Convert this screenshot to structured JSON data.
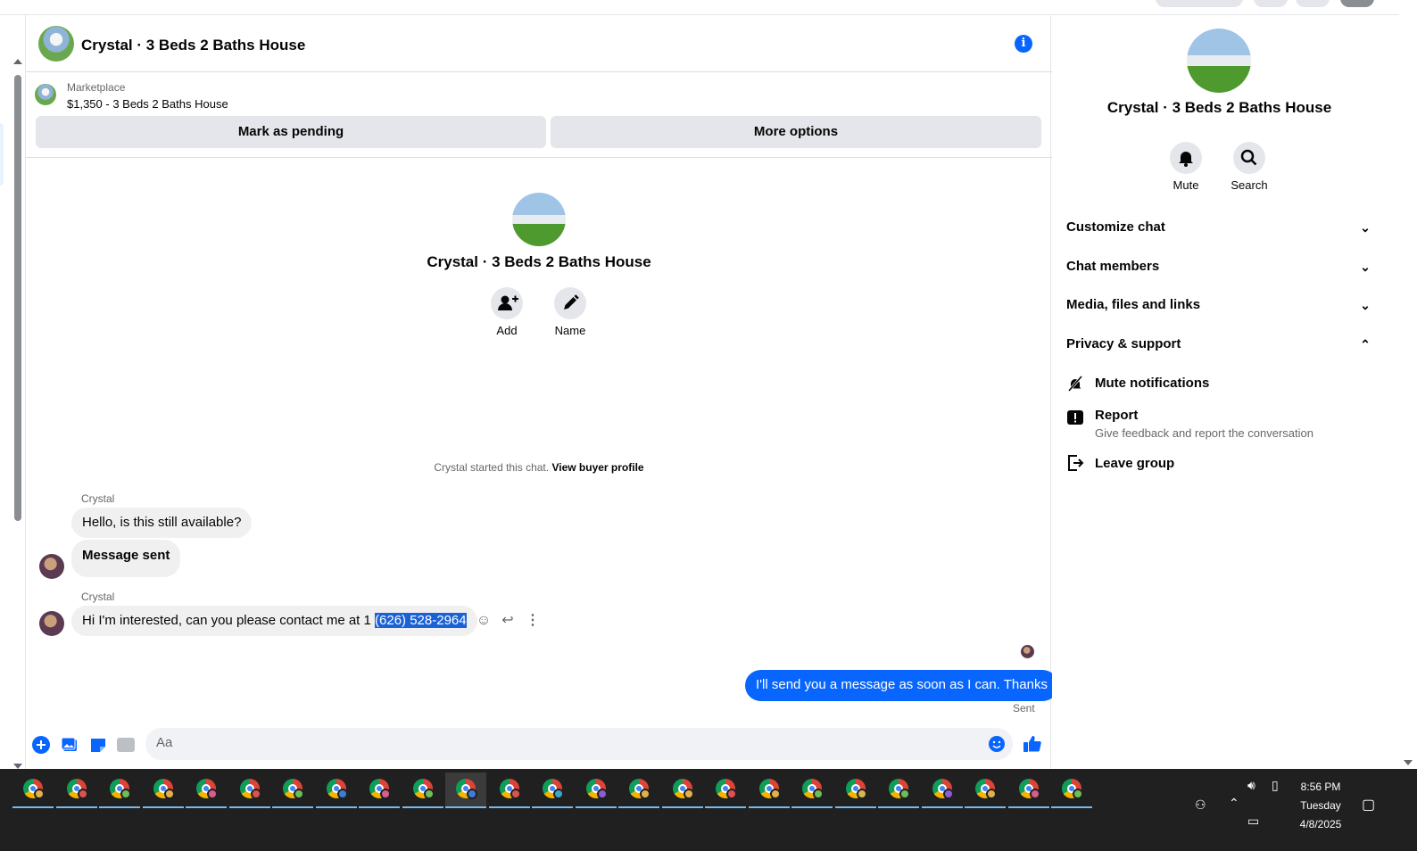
{
  "header": {
    "title": "Crystal · 3 Beds 2 Baths House"
  },
  "listing": {
    "source": "Marketplace",
    "price_title": "$1,350 - 3 Beds 2 Baths House",
    "pending_label": "Mark as pending",
    "more_label": "More options"
  },
  "profile": {
    "name": "Crystal · 3 Beds 2 Baths House",
    "add_label": "Add",
    "name_label": "Name"
  },
  "started": {
    "text": "Crystal started this chat.",
    "link": "View buyer profile"
  },
  "messages": [
    {
      "sender": "Crystal",
      "text": "Hello, is this still available?"
    },
    {
      "text": "Message sent"
    },
    {
      "sender": "Crystal",
      "text_before": "Hi I'm interested, can you please contact me at 1 ",
      "text_selected": "(626) 528-2964"
    },
    {
      "text": "I'll send you a message as soon as I can. Thanks",
      "status": "Sent"
    }
  ],
  "composer": {
    "placeholder": "Aa"
  },
  "right_panel": {
    "name": "Crystal · 3 Beds 2 Baths House",
    "mute_label": "Mute",
    "search_label": "Search",
    "sections": [
      "Customize chat",
      "Chat members",
      "Media, files and links",
      "Privacy & support"
    ],
    "privacy_items": [
      {
        "title": "Mute notifications"
      },
      {
        "title": "Report",
        "subtitle": "Give feedback and report the conversation"
      },
      {
        "title": "Leave group"
      }
    ]
  },
  "taskbar": {
    "time": "8:56 PM",
    "day": "Tuesday",
    "date": "4/8/2025"
  },
  "colors": {
    "accent": "#0866ff",
    "bubble_in": "#f0f0f0",
    "taskbar": "#202020"
  }
}
